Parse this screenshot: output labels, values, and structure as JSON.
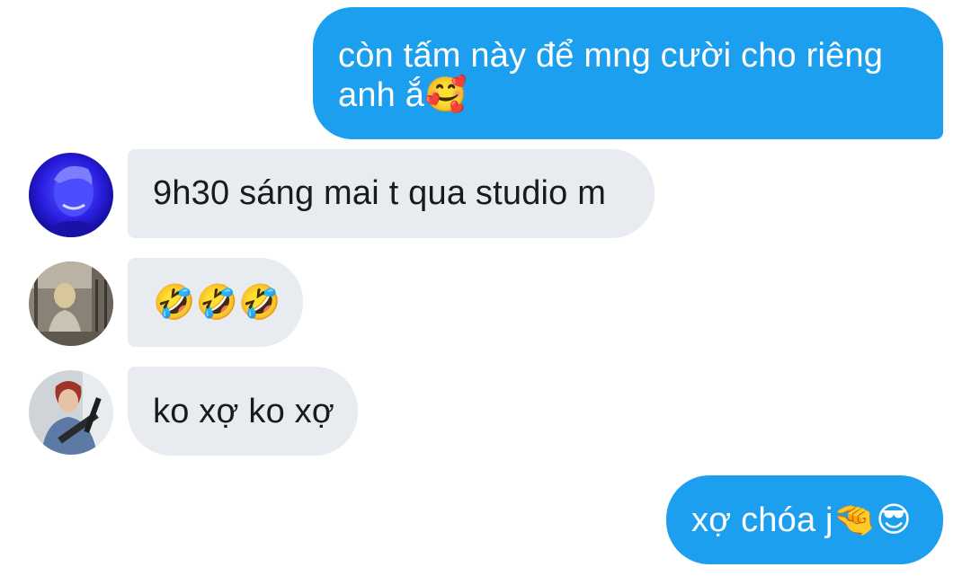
{
  "messages": [
    {
      "sender": "me",
      "text": "còn tấm này để mng cười cho riêng anh ắ🥰"
    },
    {
      "sender": "participant-1",
      "text": "9h30 sáng mai t qua studio m"
    },
    {
      "sender": "participant-2",
      "text": "🤣🤣🤣"
    },
    {
      "sender": "participant-3",
      "text": "ko xợ ko xợ"
    },
    {
      "sender": "me",
      "text": "xợ chóa j🤏😎"
    }
  ],
  "colors": {
    "outgoing_bubble": "#1d9ff0",
    "incoming_bubble": "#e8ecf0",
    "outgoing_text": "#ffffff",
    "incoming_text": "#1a1a1a"
  }
}
